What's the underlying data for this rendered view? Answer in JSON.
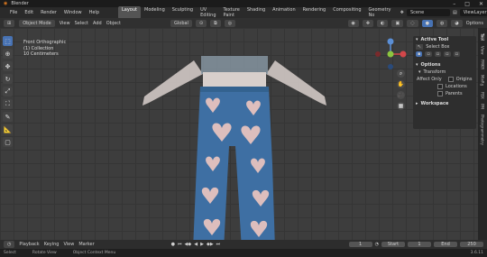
{
  "window": {
    "title": "Blender"
  },
  "menu": [
    "File",
    "Edit",
    "Render",
    "Window",
    "Help"
  ],
  "workspaces": [
    "Layout",
    "Modeling",
    "Sculpting",
    "UV Editing",
    "Texture Paint",
    "Shading",
    "Animation",
    "Rendering",
    "Compositing",
    "Geometry No"
  ],
  "scene": {
    "label": "Scene",
    "view_layer": "ViewLayer"
  },
  "header": {
    "editor_type": "⊞",
    "mode": "Object Mode",
    "menus": [
      "View",
      "Select",
      "Add",
      "Object"
    ],
    "orientation": "Global",
    "options": "Options"
  },
  "viewport": {
    "view_name": "Front Orthographic",
    "collection": "(1) Collection",
    "scale": "10 Centimeters"
  },
  "npanel": {
    "active_tool_title": "Active Tool",
    "select_box": "Select Box",
    "options_title": "Options",
    "transform_title": "Transform",
    "affect_only": "Affect Only",
    "origins": "Origins",
    "locations": "Locations",
    "parents": "Parents",
    "workspace_title": "Workspace"
  },
  "sidetabs": [
    "Tool",
    "View",
    "FMKR",
    "MixRg",
    "FBX",
    "PM",
    "Photogrammetry"
  ],
  "timeline": {
    "menus": [
      "Playback",
      "Keying",
      "View",
      "Marker"
    ],
    "current_frame": "1",
    "start_label": "Start",
    "start": "1",
    "end_label": "End",
    "end": "250"
  },
  "status": {
    "select": "Select",
    "rotate": "Rotate View",
    "context": "Object Context Menu",
    "version": "3.6.11"
  },
  "colors": {
    "accent": "#4772b3",
    "orange": "#e07a1f"
  }
}
